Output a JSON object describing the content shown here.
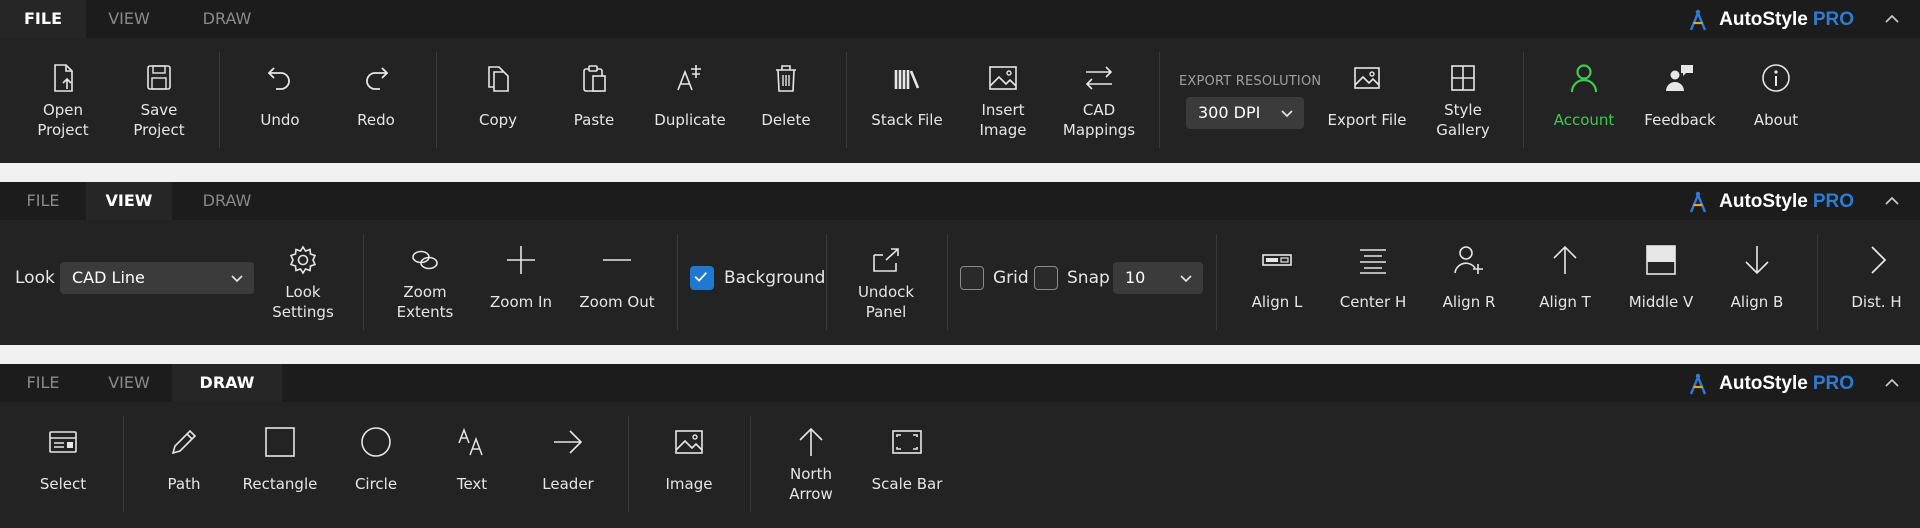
{
  "brand": {
    "name": "AutoStyle",
    "pro": "PRO"
  },
  "tabs": {
    "file": "FILE",
    "view": "VIEW",
    "draw": "DRAW"
  },
  "file_ribbon": {
    "open_project": "Open\nProject",
    "save_project": "Save\nProject",
    "undo": "Undo",
    "redo": "Redo",
    "copy": "Copy",
    "paste": "Paste",
    "duplicate": "Duplicate",
    "delete": "Delete",
    "stack_file": "Stack File",
    "insert_image": "Insert\nImage",
    "cad_mappings": "CAD\nMappings",
    "export_resolution_label": "EXPORT RESOLUTION",
    "export_resolution_value": "300 DPI",
    "export_file": "Export File",
    "style_gallery": "Style\nGallery",
    "account": "Account",
    "feedback": "Feedback",
    "about": "About"
  },
  "view_ribbon": {
    "look_label": "Look",
    "look_value": "CAD Line",
    "look_settings": "Look\nSettings",
    "zoom_extents": "Zoom\nExtents",
    "zoom_in": "Zoom In",
    "zoom_out": "Zoom Out",
    "background": "Background",
    "background_checked": true,
    "undock_panel": "Undock\nPanel",
    "grid": "Grid",
    "snap": "Snap",
    "snap_value": "10",
    "align_l": "Align L",
    "center_h": "Center H",
    "align_r": "Align R",
    "align_t": "Align T",
    "middle_v": "Middle V",
    "align_b": "Align B",
    "dist_h": "Dist. H"
  },
  "draw_ribbon": {
    "select": "Select",
    "path": "Path",
    "rectangle": "Rectangle",
    "circle": "Circle",
    "text": "Text",
    "leader": "Leader",
    "image": "Image",
    "north_arrow": "North\nArrow",
    "scale_bar": "Scale Bar"
  },
  "colors": {
    "accent_blue": "#2e7bd6",
    "account_green": "#3fc955",
    "ribbon_bg": "#232323",
    "tabbar_bg": "#1c1c1c"
  }
}
